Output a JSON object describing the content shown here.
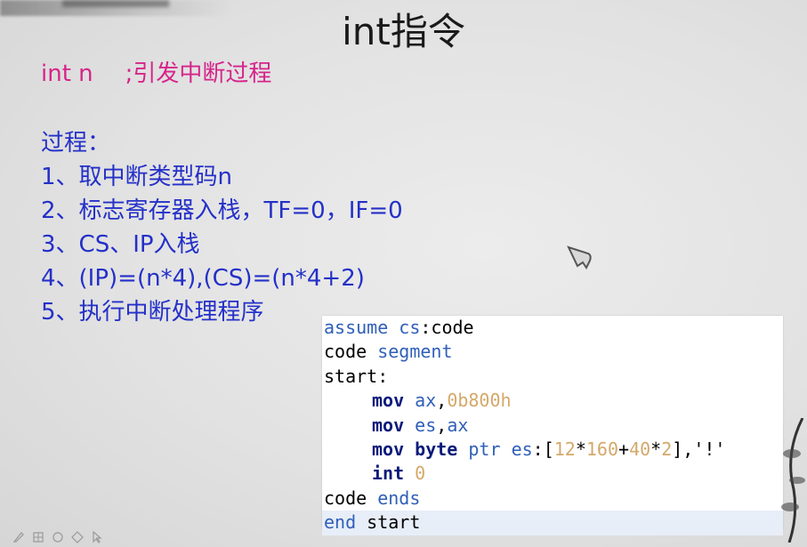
{
  "slide": {
    "title": "int指令",
    "int_instruction": "int n",
    "int_comment": ";引发中断过程",
    "process_heading": "过程：",
    "steps": [
      "1、取中断类型码n",
      "2、标志寄存器入栈，TF=0，IF=0",
      "3、CS、IP入栈",
      "4、(IP)=(n*4),(CS)=(n*4+2)",
      "5、执行中断处理程序"
    ]
  },
  "code": {
    "l1_a": "assume ",
    "l1_b": "cs",
    "l1_c": ":code",
    "l2_a": "code ",
    "l2_b": "segment",
    "l3": "start:",
    "l4_op": "mov",
    "l4_sp": " ",
    "l4_r": "ax",
    "l4_c": ",",
    "l4_n": "0b800h",
    "l5_op": "mov",
    "l5_sp": " ",
    "l5_r1": "es",
    "l5_c": ",",
    "l5_r2": "ax",
    "l6_op": "mov",
    "l6_sp": " ",
    "l6_byte": "byte",
    "l6_sp2": " ",
    "l6_ptr": "ptr",
    "l6_sp3": " ",
    "l6_es": "es",
    "l6_a": ":[",
    "l6_n1": "12",
    "l6_b": "*",
    "l6_n2": "160",
    "l6_c": "+",
    "l6_n3": "40",
    "l6_d": "*",
    "l6_n4": "2",
    "l6_e": "],'!'",
    "l7_op": "int",
    "l7_sp": " ",
    "l7_n": "0",
    "l8_a": "code ",
    "l8_b": "ends",
    "l9_a": "end",
    "l9_b": " start"
  },
  "colors": {
    "title": "#1a1a1a",
    "int_line": "#d6248a",
    "steps": "#2430c8",
    "code_keyword": "#2f5fb8",
    "code_number": "#d4a86a"
  },
  "icons": [
    "pen-icon",
    "grid-icon",
    "eraser-icon",
    "diamond-icon",
    "pointer-icon",
    "mouse-cursor-icon"
  ]
}
